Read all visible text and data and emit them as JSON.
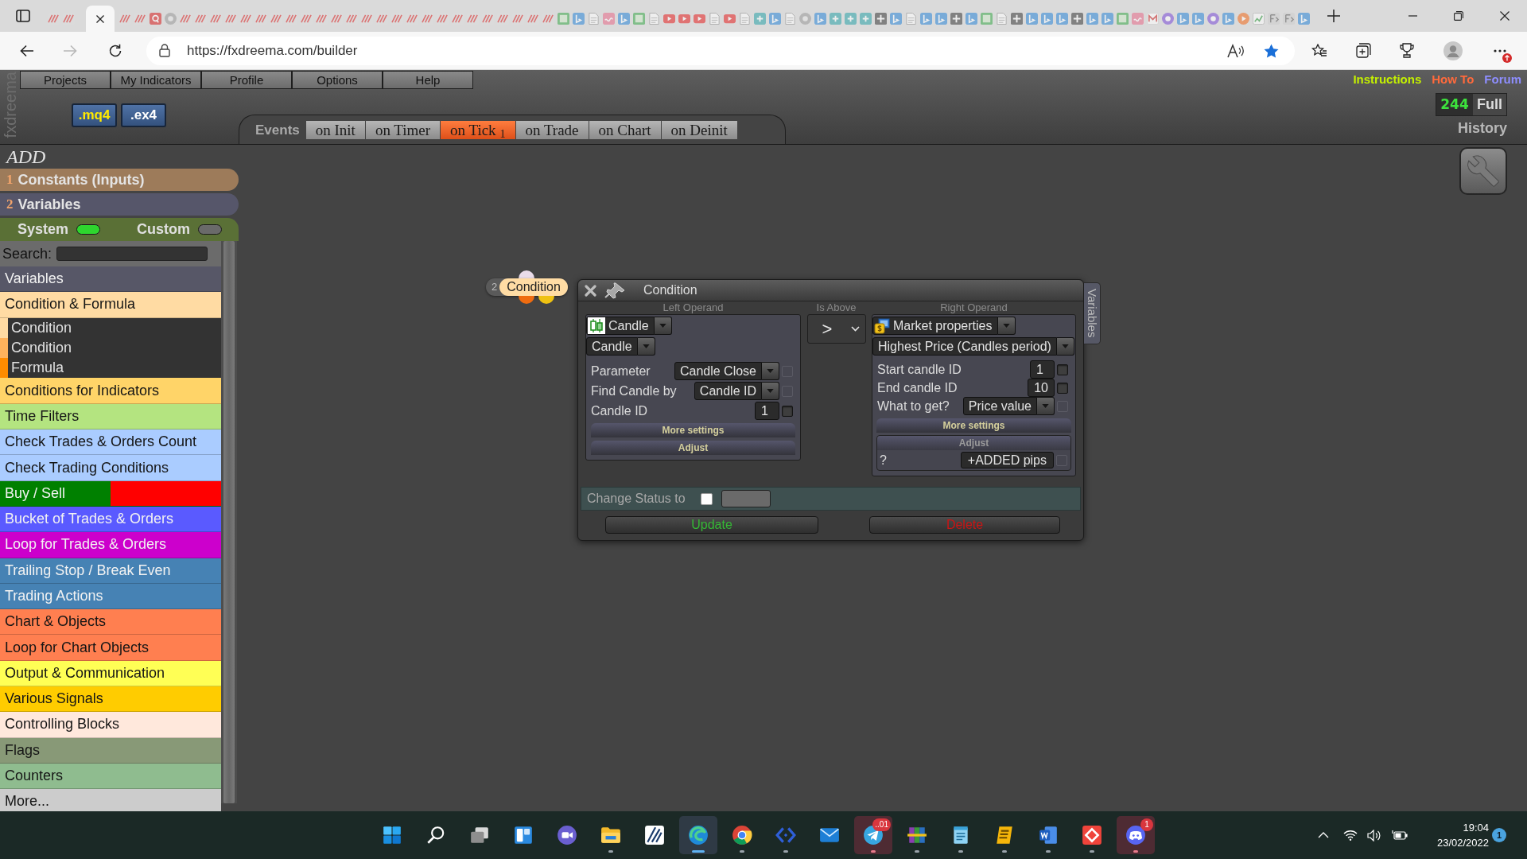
{
  "browser": {
    "tabs": [
      {
        "selected": false
      },
      {
        "selected": false
      },
      {
        "selected": true
      },
      {
        "selected": false
      },
      {
        "selected": false
      },
      {
        "selected": false
      },
      {
        "selected": false
      },
      {
        "selected": false
      },
      {
        "selected": false
      },
      {
        "selected": false
      },
      {
        "selected": false
      },
      {
        "selected": false
      },
      {
        "selected": false
      },
      {
        "selected": false
      },
      {
        "selected": false
      },
      {
        "selected": false
      },
      {
        "selected": false
      },
      {
        "selected": false
      },
      {
        "selected": false
      },
      {
        "selected": false
      },
      {
        "selected": false
      },
      {
        "selected": false
      },
      {
        "selected": false
      },
      {
        "selected": false
      },
      {
        "selected": false
      },
      {
        "selected": false
      },
      {
        "selected": false
      },
      {
        "selected": false
      },
      {
        "selected": false
      },
      {
        "selected": false
      },
      {
        "selected": false
      },
      {
        "selected": false
      },
      {
        "selected": false
      },
      {
        "selected": false
      },
      {
        "selected": false
      },
      {
        "selected": false
      },
      {
        "selected": false
      },
      {
        "selected": false
      },
      {
        "selected": false
      },
      {
        "selected": false
      },
      {
        "selected": false
      },
      {
        "selected": false
      },
      {
        "selected": false
      },
      {
        "selected": false
      },
      {
        "selected": false
      },
      {
        "selected": false
      },
      {
        "selected": false
      },
      {
        "selected": false
      },
      {
        "selected": false
      },
      {
        "selected": false
      },
      {
        "selected": false
      },
      {
        "selected": false
      },
      {
        "selected": false
      },
      {
        "selected": false
      },
      {
        "selected": false
      },
      {
        "selected": false
      },
      {
        "selected": false
      },
      {
        "selected": false
      },
      {
        "selected": false
      },
      {
        "selected": false
      },
      {
        "selected": false
      },
      {
        "selected": false
      },
      {
        "selected": false
      },
      {
        "selected": false
      },
      {
        "selected": false
      },
      {
        "selected": false
      },
      {
        "selected": false
      },
      {
        "selected": false
      },
      {
        "selected": false
      },
      {
        "selected": false
      },
      {
        "selected": false
      },
      {
        "selected": false
      },
      {
        "selected": false
      },
      {
        "selected": false
      },
      {
        "selected": false
      },
      {
        "selected": false
      },
      {
        "selected": false
      },
      {
        "selected": false
      },
      {
        "selected": false
      },
      {
        "selected": false
      },
      {
        "selected": false
      },
      {
        "selected": false
      }
    ],
    "url": "https://fxdreema.com/builder"
  },
  "app": {
    "logo": "fxdreema",
    "menu": [
      "Projects",
      "My Indicators",
      "Profile",
      "Options",
      "Help"
    ],
    "export_buttons": [
      {
        "label": ".mq4",
        "kind": "source"
      },
      {
        "label": ".ex4",
        "kind": "compiled"
      }
    ],
    "events": {
      "label": "Events",
      "tabs": [
        {
          "label": "on Init",
          "selected": false
        },
        {
          "label": "on Timer",
          "selected": false
        },
        {
          "label": "on Tick $_{1}$",
          "selected": true
        },
        {
          "label": "on Trade",
          "selected": false
        },
        {
          "label": "on Chart",
          "selected": false
        },
        {
          "label": "on Deinit",
          "selected": false
        }
      ]
    },
    "links": [
      {
        "label": "Instructions",
        "color": "#c4f000"
      },
      {
        "label": "How To",
        "color": "#ff6a3c"
      },
      {
        "label": "Forum",
        "color": "#8e8eff"
      }
    ],
    "counter": {
      "value": "244",
      "label": "Full"
    },
    "history": "History"
  },
  "sidebar": {
    "title": "ADD",
    "sections": [
      {
        "number": "1",
        "label": "Constants (Inputs)",
        "color": "#9d7b5a"
      },
      {
        "number": "2",
        "label": "Variables",
        "color": "#56566a"
      }
    ],
    "filters": [
      {
        "label": "System",
        "on": true
      },
      {
        "label": "Custom",
        "on": false
      }
    ],
    "search": {
      "label": "Search:"
    },
    "categories": [
      {
        "label": "Variables",
        "color": "#575767"
      },
      {
        "label": "Condition & Formula",
        "color": "#ffdba3",
        "children": [
          {
            "label": "Condition",
            "color": "#ffdba3"
          },
          {
            "label": "Condition",
            "color": "#ffb35c"
          },
          {
            "label": "Formula",
            "color": "#ff8c00"
          }
        ]
      },
      {
        "label": "Conditions for Indicators",
        "color": "#ffd468"
      },
      {
        "label": "Time Filters",
        "color": "#b4e480"
      },
      {
        "label": "Check Trades & Orders Count",
        "color": "#aaccff"
      },
      {
        "label": "Check Trading Conditions",
        "color": "#aaccff"
      },
      {
        "label": "Buy / Sell",
        "color": "#008000",
        "band": {
          "color": "#ff0000"
        }
      },
      {
        "label": "Bucket of Trades & Orders",
        "color": "#5a5aff"
      },
      {
        "label": "Loop for Trades & Orders",
        "color": "#cc00cc"
      },
      {
        "label": "Trailing Stop / Break Even",
        "color": "#4682b4"
      },
      {
        "label": "Trading Actions",
        "color": "#4682b4"
      },
      {
        "label": "Chart & Objects",
        "color": "#ff7f50"
      },
      {
        "label": "Loop for Chart Objects",
        "color": "#ff7f50"
      },
      {
        "label": "Output & Communication",
        "color": "#ffff55"
      },
      {
        "label": "Various Signals",
        "color": "#ffcc00"
      },
      {
        "label": "Controlling Blocks",
        "color": "#ffe8dc"
      },
      {
        "label": "Flags",
        "color": "#889977"
      },
      {
        "label": "Counters",
        "color": "#8fbc8f"
      },
      {
        "label": "More...",
        "color": "#cccccc"
      }
    ]
  },
  "canvas": {
    "blocks": [
      {
        "number": "2",
        "title": "Condition"
      }
    ]
  },
  "dialog": {
    "title": "Condition",
    "side_tab": "Variables",
    "left_operand": {
      "heading": "Left Operand",
      "source": {
        "kind": "candle",
        "value": "Candle"
      },
      "type": "Candle",
      "rows": [
        {
          "label": "Parameter",
          "kind": "dropdown",
          "value": "Candle Close",
          "checkbox": {
            "checked": false,
            "disabled": true
          }
        },
        {
          "label": "Find Candle by",
          "kind": "dropdown",
          "value": "Candle ID",
          "checkbox": {
            "checked": false,
            "disabled": true
          }
        },
        {
          "label": "Candle ID",
          "kind": "number",
          "value": "1",
          "checkbox": {
            "checked": false,
            "disabled": false
          }
        }
      ],
      "more_settings": "More settings",
      "adjust": {
        "label": "Adjust",
        "expanded": false
      }
    },
    "operator": {
      "heading": "Is Above",
      "value": ">"
    },
    "right_operand": {
      "heading": "Right Operand",
      "source": {
        "kind": "market",
        "value": "Market properties"
      },
      "type": "Highest Price (Candles period)",
      "rows": [
        {
          "label": "Start candle ID",
          "kind": "number",
          "value": "1",
          "checkbox": {
            "checked": false,
            "disabled": false
          }
        },
        {
          "label": "End candle ID",
          "kind": "number",
          "value": "10",
          "checkbox": {
            "checked": false,
            "disabled": false
          }
        },
        {
          "label": "What to get?",
          "kind": "dropdown",
          "value": "Price value",
          "checkbox": {
            "checked": false,
            "disabled": true
          }
        }
      ],
      "more_settings": "More settings",
      "adjust": {
        "label": "Adjust",
        "expanded": true,
        "rows": [
          {
            "label": "?",
            "kind": "field",
            "value": "+ADDED pips",
            "checkbox": {
              "checked": false,
              "disabled": true
            }
          }
        ]
      }
    },
    "change_status": {
      "label": "Change Status to",
      "checked": false
    },
    "buttons": [
      {
        "label": "Update",
        "kind": "update"
      },
      {
        "label": "Delete",
        "kind": "delete"
      }
    ]
  },
  "taskbar": {
    "apps": [
      {
        "running": true,
        "active": false,
        "flashing": false
      },
      {
        "running": false,
        "active": false,
        "flashing": false
      },
      {
        "running": true,
        "active": true,
        "flashing": false
      },
      {
        "running": true,
        "active": false,
        "flashing": false
      },
      {
        "running": true,
        "active": false,
        "flashing": false
      },
      {
        "running": false,
        "active": false,
        "flashing": false
      },
      {
        "running": true,
        "active": false,
        "flashing": true,
        "badge": "..01"
      },
      {
        "running": true,
        "active": false,
        "flashing": false
      },
      {
        "running": true,
        "active": false,
        "flashing": false
      },
      {
        "running": true,
        "active": false,
        "flashing": false
      },
      {
        "running": true,
        "active": false,
        "flashing": false
      },
      {
        "running": true,
        "active": false,
        "flashing": false
      },
      {
        "running": true,
        "active": false,
        "flashing": true,
        "badge": "1"
      }
    ],
    "tray": {
      "time": "19:04",
      "date": "23/02/2022",
      "notifications": "1"
    }
  }
}
